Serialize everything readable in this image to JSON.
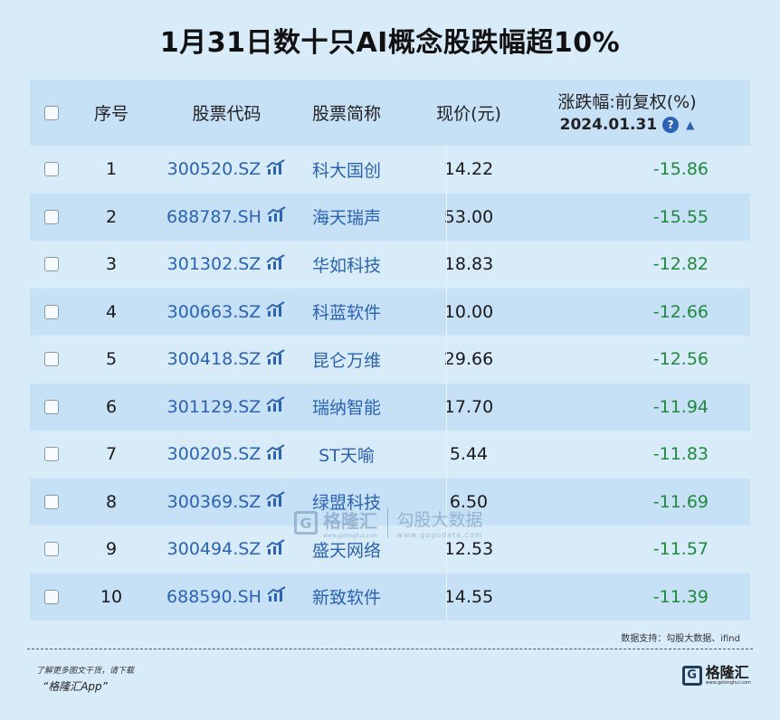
{
  "title": "1月31日数十只AI概念股跌幅超10%",
  "header": {
    "idx": "序号",
    "code": "股票代码",
    "name": "股票简称",
    "price": "现价(元)",
    "change": "涨跌幅:前复权(%)",
    "date": "2024.01.31",
    "help_icon": "?",
    "sort_icon": "▲"
  },
  "rows": [
    {
      "idx": "1",
      "code": "300520.SZ",
      "name": "科大国创",
      "price": "14.22",
      "change": "-15.86"
    },
    {
      "idx": "2",
      "code": "688787.SH",
      "name": "海天瑞声",
      "price": "53.00",
      "change": "-15.55"
    },
    {
      "idx": "3",
      "code": "301302.SZ",
      "name": "华如科技",
      "price": "18.83",
      "change": "-12.82"
    },
    {
      "idx": "4",
      "code": "300663.SZ",
      "name": "科蓝软件",
      "price": "10.00",
      "change": "-12.66"
    },
    {
      "idx": "5",
      "code": "300418.SZ",
      "name": "昆仑万维",
      "price": "29.66",
      "change": "-12.56"
    },
    {
      "idx": "6",
      "code": "301129.SZ",
      "name": "瑞纳智能",
      "price": "17.70",
      "change": "-11.94"
    },
    {
      "idx": "7",
      "code": "300205.SZ",
      "name": "ST天喻",
      "price": "5.44",
      "change": "-11.83"
    },
    {
      "idx": "8",
      "code": "300369.SZ",
      "name": "绿盟科技",
      "price": "6.50",
      "change": "-11.69"
    },
    {
      "idx": "9",
      "code": "300494.SZ",
      "name": "盛天网络",
      "price": "12.53",
      "change": "-11.57"
    },
    {
      "idx": "10",
      "code": "688590.SH",
      "name": "新致软件",
      "price": "14.55",
      "change": "-11.39"
    }
  ],
  "watermark": {
    "logo_letter": "G",
    "name": "格隆汇",
    "url_small": "www.gelonghui.com",
    "right_big": "勾股大数据",
    "right_small": "www.gogudata.com"
  },
  "source": "数据支持：勾股大数据、ifind",
  "footer": {
    "line1": "了解更多图文干货，请下载",
    "line2": "“格隆汇App”",
    "logo_letter": "G",
    "logo_name": "格隆汇",
    "logo_url": "www.gelonghui.com"
  },
  "colors": {
    "background": "#d8ebf9",
    "band": "#c6e0f5",
    "link_blue": "#2a63b8",
    "negative_green": "#1f8a3c"
  }
}
